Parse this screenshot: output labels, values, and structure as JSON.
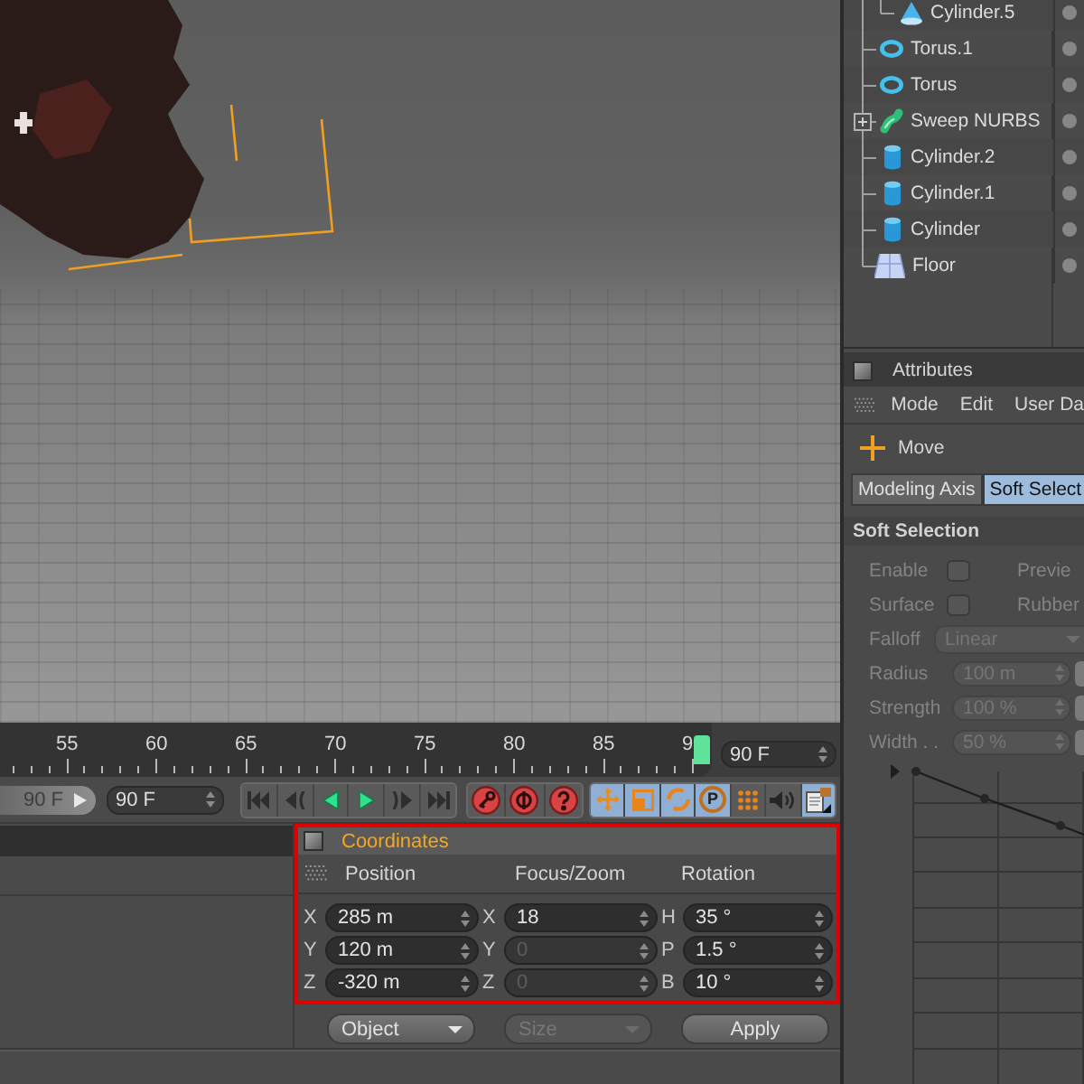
{
  "object_manager": {
    "objects": [
      {
        "children": [
          {
            "name": "Cylinder.5",
            "kind": "cone"
          }
        ]
      },
      {
        "name": "Torus.1",
        "kind": "torus"
      },
      {
        "name": "Torus",
        "kind": "torus"
      },
      {
        "name": "Sweep NURBS",
        "kind": "sweep",
        "expanded": false
      },
      {
        "name": "Cylinder.2",
        "kind": "cylinder"
      },
      {
        "name": "Cylinder.1",
        "kind": "cylinder"
      },
      {
        "name": "Cylinder",
        "kind": "cylinder"
      },
      {
        "name": "Floor",
        "kind": "floor"
      }
    ]
  },
  "attributes": {
    "title": "Attributes",
    "menu": [
      "Mode",
      "Edit",
      "User Da"
    ],
    "tool": "Move",
    "tabs": [
      {
        "label": "Modeling Axis",
        "selected": false
      },
      {
        "label": "Soft Select",
        "selected": true
      }
    ],
    "section": "Soft Selection",
    "rows": [
      {
        "kind": "checkbox",
        "label": "Enable",
        "checked": false,
        "disabled": true,
        "side_label": "Previe"
      },
      {
        "kind": "checkbox",
        "label": "Surface",
        "checked": false,
        "disabled": true,
        "side_label": "Rubber"
      },
      {
        "kind": "dropdown",
        "label": "Falloff",
        "value": "Linear",
        "disabled": true
      },
      {
        "kind": "number",
        "label": "Radius",
        "value": "100 m",
        "disabled": true
      },
      {
        "kind": "number",
        "label": "Strength",
        "value": "100 %",
        "disabled": true
      },
      {
        "kind": "number",
        "label": "Width . .",
        "value": "50 %",
        "disabled": true
      }
    ]
  },
  "timeline": {
    "ruler_labels": [
      "55",
      "60",
      "65",
      "70",
      "75",
      "80",
      "85",
      "9"
    ],
    "frame_field": "90 F"
  },
  "playback": {
    "end_button": "90 F",
    "frame_field": "90 F",
    "key_filters": [
      {
        "kind": "move",
        "on": true
      },
      {
        "kind": "scale",
        "on": true
      },
      {
        "kind": "rotate",
        "on": true
      },
      {
        "kind": "parameter",
        "on": true,
        "label": "P"
      },
      {
        "kind": "points",
        "on": false
      },
      {
        "kind": "sound",
        "on": false
      },
      {
        "kind": "document",
        "on": true
      }
    ]
  },
  "coordinates": {
    "title": "Coordinates",
    "columns": [
      {
        "heading": "Position",
        "fields": [
          {
            "axis": "X",
            "value": "285 m",
            "disabled": false
          },
          {
            "axis": "Y",
            "value": "120 m",
            "disabled": false
          },
          {
            "axis": "Z",
            "value": "-320 m",
            "disabled": false
          }
        ]
      },
      {
        "heading": "Focus/Zoom",
        "fields": [
          {
            "axis": "X",
            "value": "18",
            "disabled": false
          },
          {
            "axis": "Y",
            "value": "0",
            "disabled": true
          },
          {
            "axis": "Z",
            "value": "0",
            "disabled": true
          }
        ]
      },
      {
        "heading": "Rotation",
        "fields": [
          {
            "axis": "H",
            "value": "35 °",
            "disabled": false
          },
          {
            "axis": "P",
            "value": "1.5 °",
            "disabled": false
          },
          {
            "axis": "B",
            "value": "10 °",
            "disabled": false
          }
        ]
      }
    ],
    "buttons": [
      {
        "label": "Object",
        "kind": "dropdown",
        "disabled": false
      },
      {
        "label": "Size",
        "kind": "dropdown",
        "disabled": true
      },
      {
        "label": "Apply",
        "kind": "button",
        "disabled": false
      }
    ]
  }
}
